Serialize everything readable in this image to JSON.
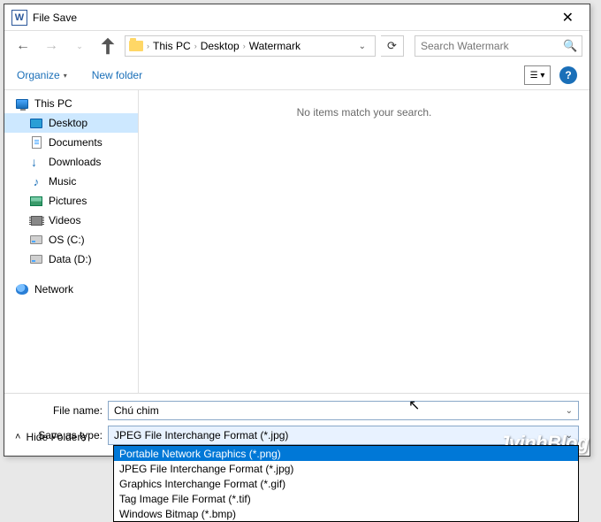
{
  "window": {
    "title": "File Save"
  },
  "breadcrumb": {
    "items": [
      "This PC",
      "Desktop",
      "Watermark"
    ]
  },
  "search": {
    "placeholder": "Search Watermark"
  },
  "toolbar": {
    "organize": "Organize",
    "new_folder": "New folder"
  },
  "sidebar": {
    "this_pc": "This PC",
    "desktop": "Desktop",
    "documents": "Documents",
    "downloads": "Downloads",
    "music": "Music",
    "pictures": "Pictures",
    "videos": "Videos",
    "os_c": "OS (C:)",
    "data_d": "Data (D:)",
    "network": "Network"
  },
  "content": {
    "empty_msg": "No items match your search."
  },
  "fields": {
    "file_name_label": "File name:",
    "file_name_value": "Chú chim",
    "save_type_label": "Save as type:",
    "save_type_value": "JPEG File Interchange Format (*.jpg)"
  },
  "dropdown": {
    "items": [
      "Portable Network Graphics (*.png)",
      "JPEG File Interchange Format (*.jpg)",
      "Graphics Interchange Format (*.gif)",
      "Tag Image File Format (*.tif)",
      "Windows Bitmap (*.bmp)"
    ],
    "selected_index": 0
  },
  "footer": {
    "hide_folders": "Hide Folders"
  },
  "watermark_text": {
    "part1": "Jvinh",
    "part2": "Blog"
  }
}
